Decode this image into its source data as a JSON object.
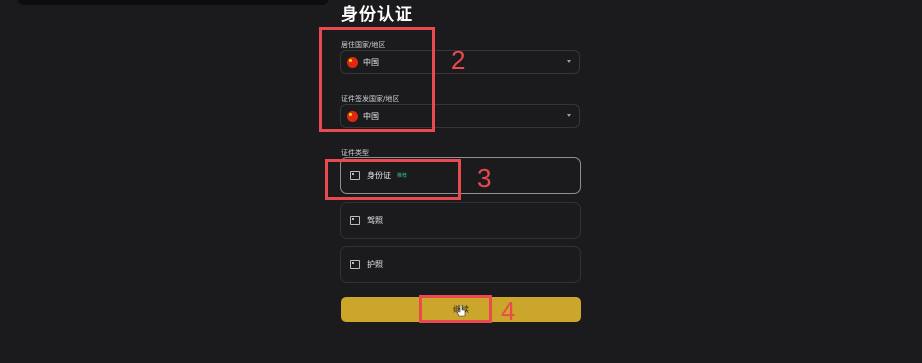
{
  "page": {
    "title": "身份认证"
  },
  "residence": {
    "label": "居住国家/地区",
    "value": "中国"
  },
  "issuing": {
    "label": "证件签发国家/地区",
    "value": "中国"
  },
  "doc_type": {
    "label": "证件类型",
    "options": [
      {
        "label": "身份证",
        "badge": "推荐",
        "icon": "id-card-icon"
      },
      {
        "label": "驾照",
        "icon": "driver-license-icon"
      },
      {
        "label": "护照",
        "icon": "passport-icon"
      }
    ]
  },
  "continue_label": "继续",
  "annotations": [
    "2",
    "3",
    "4"
  ],
  "colors": {
    "background": "#1b1b1d",
    "accent": "#cca62b",
    "annotation": "#e94a4f",
    "badge": "#2ebd85"
  }
}
